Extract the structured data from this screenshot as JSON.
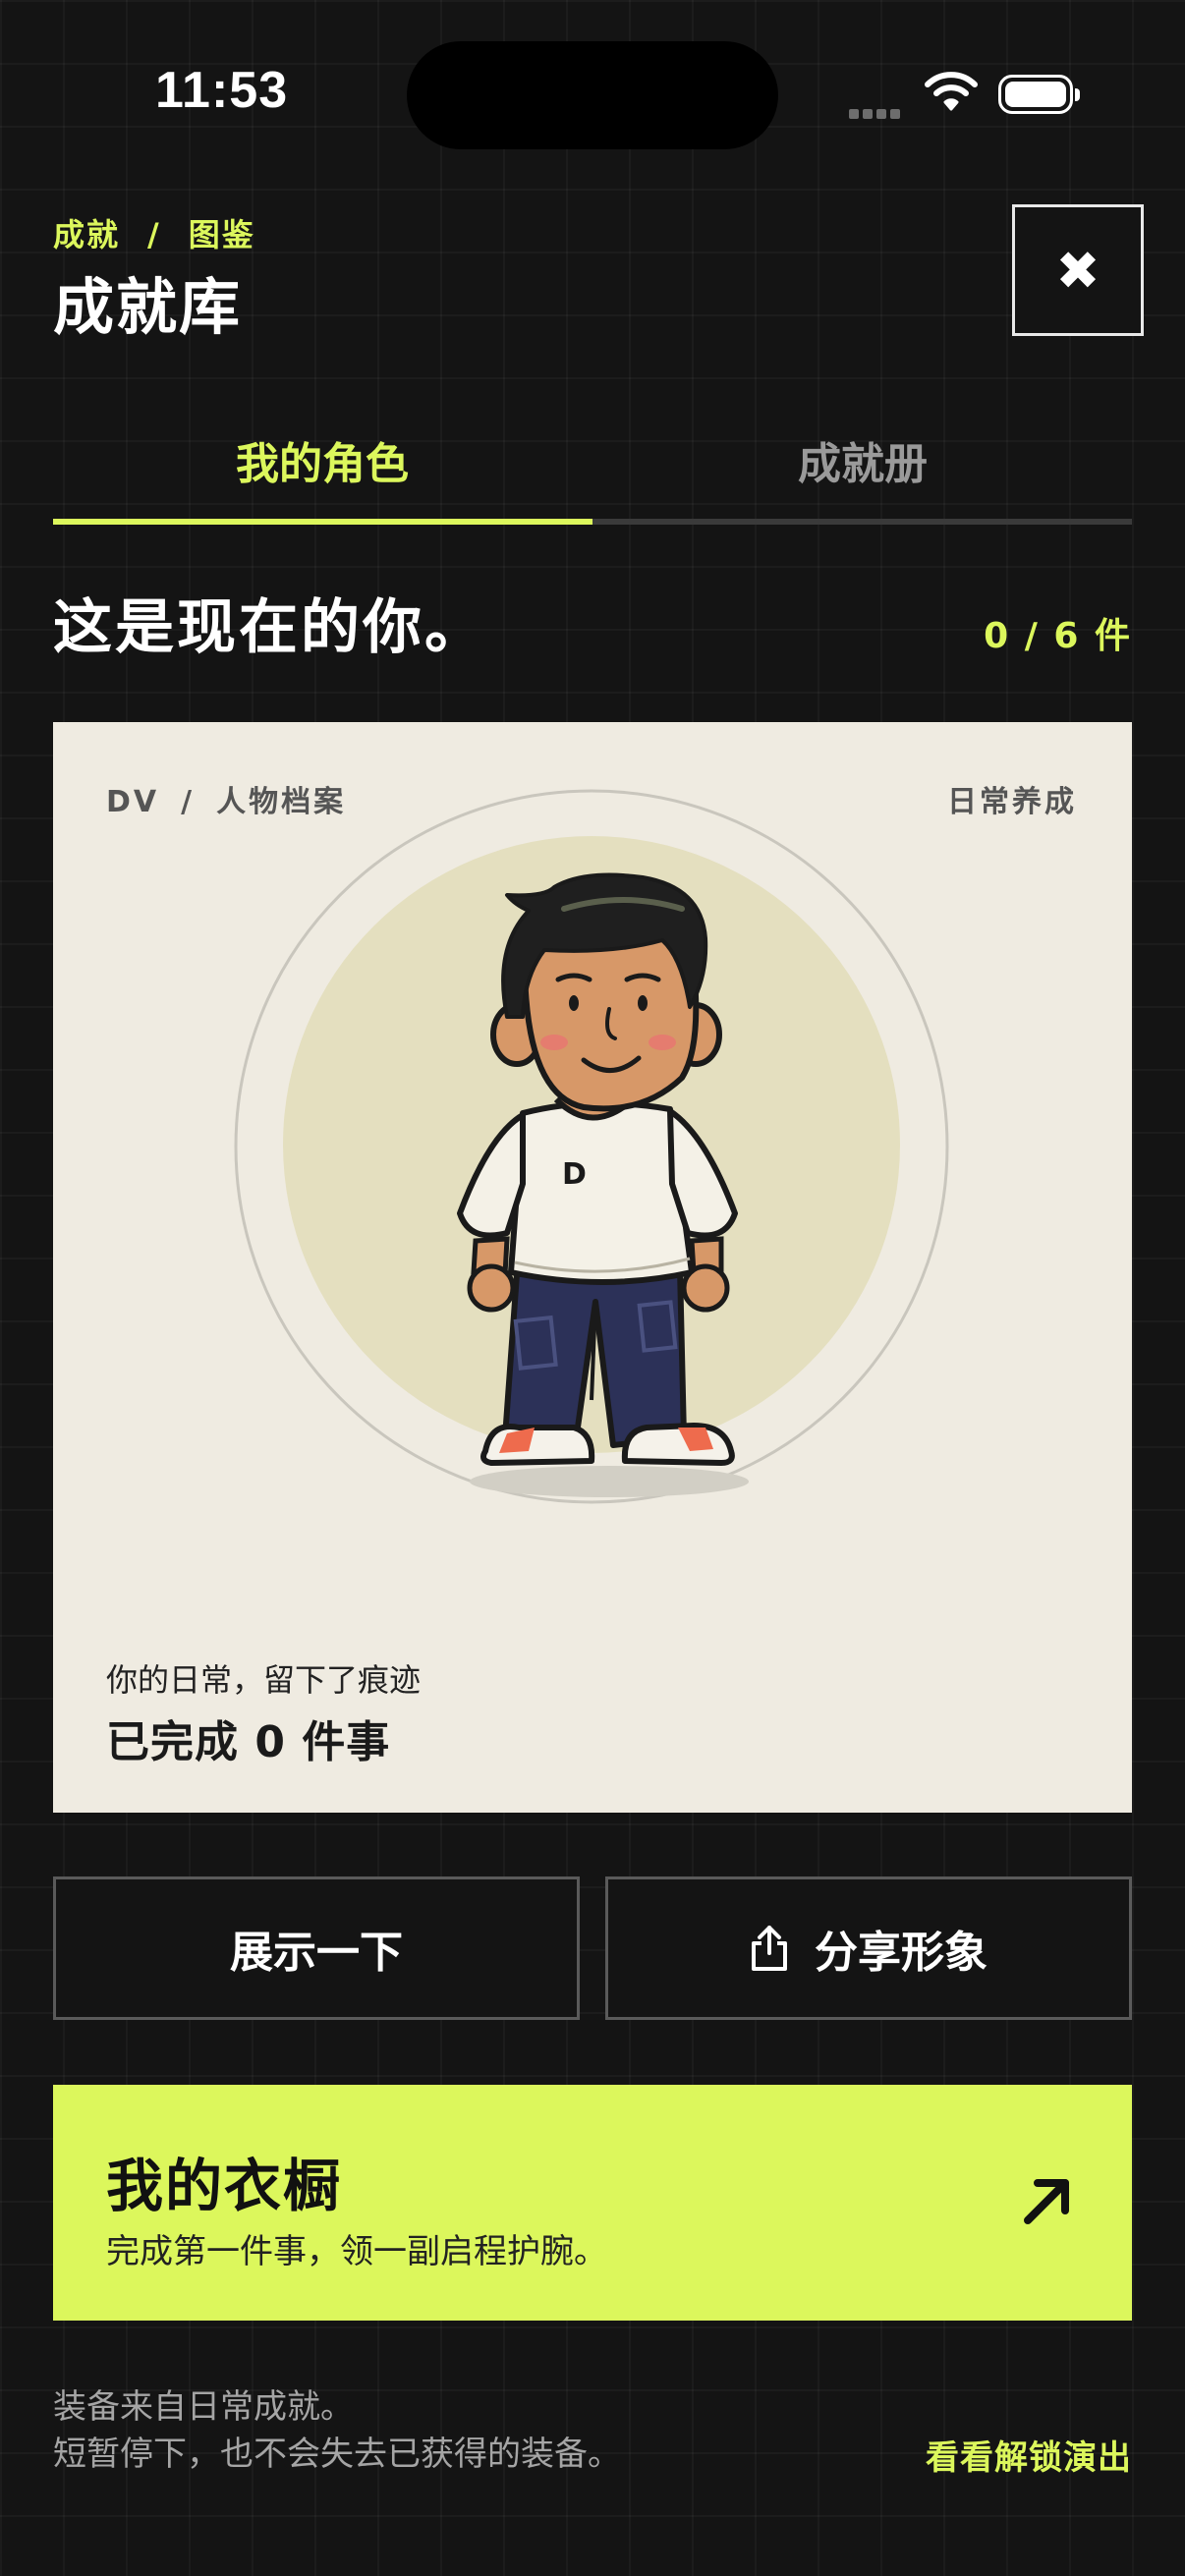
{
  "status_bar": {
    "time": "11:53"
  },
  "header": {
    "breadcrumb_first": "成就",
    "breadcrumb_sep": "/",
    "breadcrumb_second": "图鉴",
    "title": "成就库",
    "close_glyph": "✖"
  },
  "tabs": [
    {
      "label": "我的角色",
      "active": true
    },
    {
      "label": "成就册",
      "active": false
    }
  ],
  "section": {
    "title": "这是现在的你。",
    "count": "0 / 6 件"
  },
  "profile_card": {
    "label_left_a": "DV",
    "label_sep": "/",
    "label_left_b": "人物档案",
    "label_right": "日常养成",
    "shirt_letter": "D",
    "subtitle": "你的日常，留下了痕迹",
    "completed": "已完成 0 件事"
  },
  "actions": {
    "show_label": "展示一下",
    "share_label": "分享形象"
  },
  "wardrobe": {
    "title": "我的衣橱",
    "description": "完成第一件事，领一副启程护腕。"
  },
  "footer": {
    "note_line1": "装备来自日常成就。",
    "note_line2": "短暂停下，也不会失去已获得的装备。",
    "link": "看看解锁演出"
  },
  "colors": {
    "accent": "#dcf75c",
    "background": "#141414",
    "card": "#efebe1"
  },
  "icons": [
    "wifi-icon",
    "battery-icon",
    "close-icon",
    "share-icon",
    "arrow-up-right-icon"
  ]
}
